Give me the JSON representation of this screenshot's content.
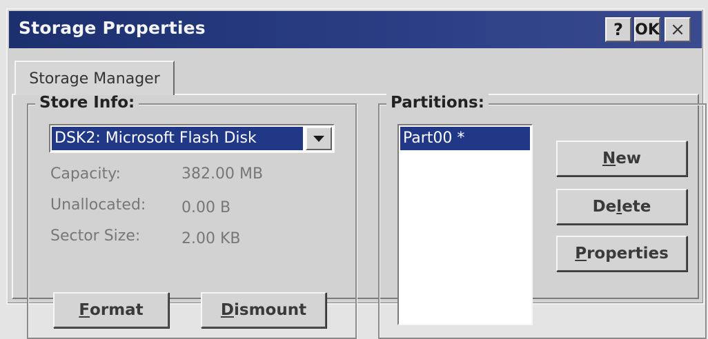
{
  "window": {
    "title": "Storage Properties",
    "help_label": "?",
    "ok_label": "OK",
    "close_label": "×"
  },
  "tabs": [
    {
      "label": "Storage Manager"
    }
  ],
  "store_info": {
    "legend": "Store Info:",
    "selected_store": "DSK2: Microsoft Flash Disk",
    "rows": [
      {
        "label": "Capacity:",
        "value": "382.00 MB"
      },
      {
        "label": "Unallocated:",
        "value": "0.00 B"
      },
      {
        "label": "Sector Size:",
        "value": "2.00 KB"
      }
    ],
    "buttons": {
      "format": {
        "mnemonic": "F",
        "rest": "ormat"
      },
      "dismount": {
        "mnemonic": "D",
        "rest": "ismount"
      }
    }
  },
  "partitions": {
    "legend": "Partitions:",
    "items": [
      {
        "label": "Part00 *",
        "selected": true
      }
    ],
    "buttons": {
      "new": {
        "mnemonic": "N",
        "rest": "ew"
      },
      "delete": {
        "pre": "De",
        "mnemonic": "l",
        "rest": "ete"
      },
      "properties": {
        "mnemonic": "P",
        "rest": "roperties"
      }
    }
  },
  "colors": {
    "titlebar": "#1c2f6e",
    "selection": "#213887",
    "face": "#d2d2d2"
  },
  "icons": {
    "dropdown": "chevron-down-icon"
  }
}
